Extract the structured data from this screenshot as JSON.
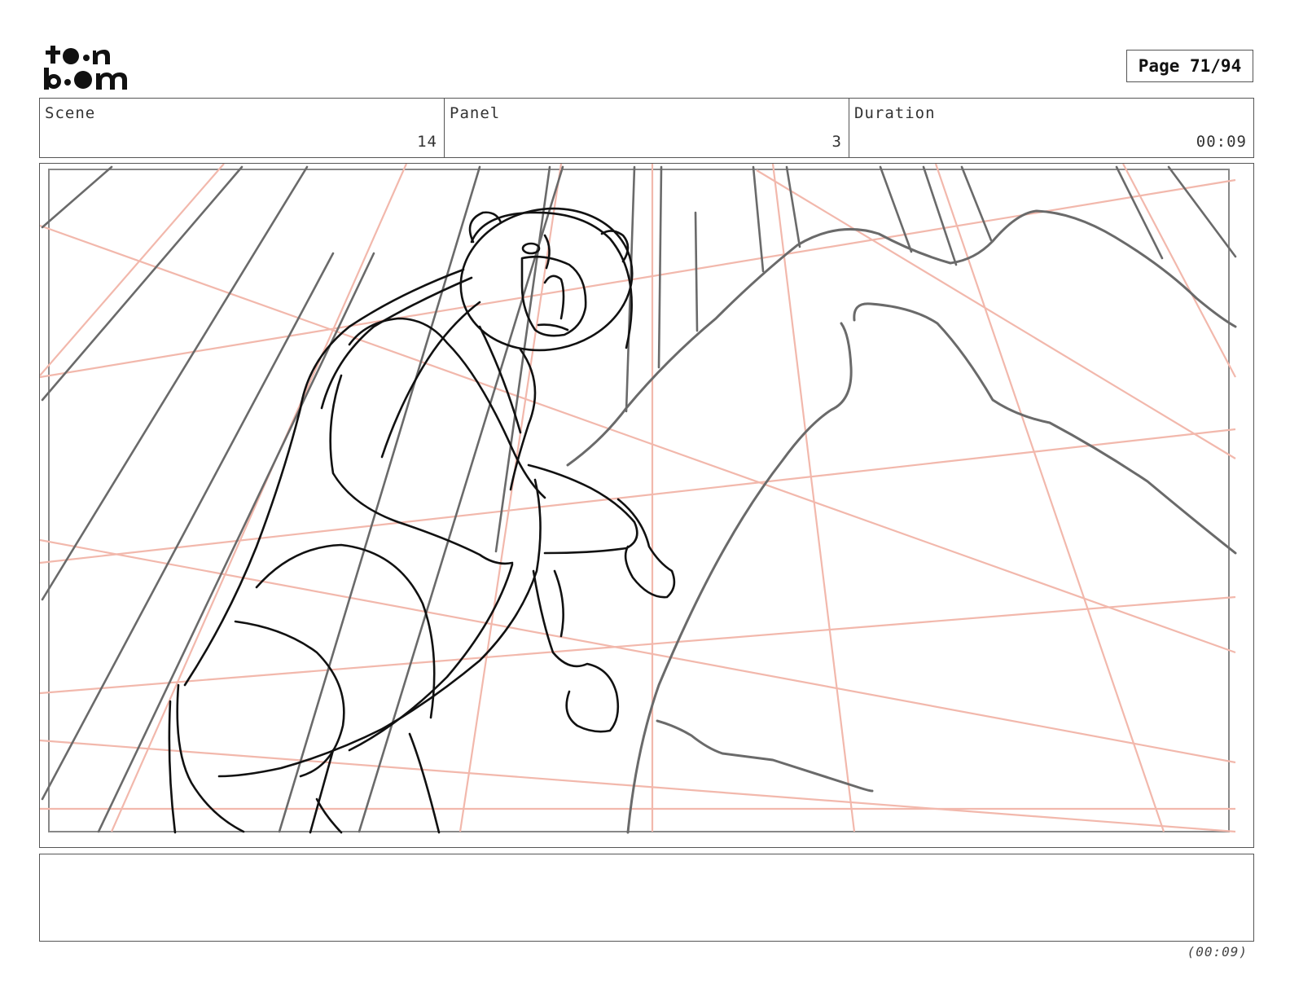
{
  "logo": {
    "line1": "toon",
    "line2": "boom"
  },
  "page": {
    "label": "Page 71/94"
  },
  "info": {
    "scene_label": "Scene",
    "scene_value": "14",
    "panel_label": "Panel",
    "panel_value": "3",
    "duration_label": "Duration",
    "duration_value": "00:09"
  },
  "notes": {
    "text": ""
  },
  "footer": {
    "duration": "(00:09)"
  },
  "colors": {
    "border": "#555555",
    "sketch": "#111111",
    "guide": "#f2b8ac",
    "rough": "#6a6a6a"
  }
}
